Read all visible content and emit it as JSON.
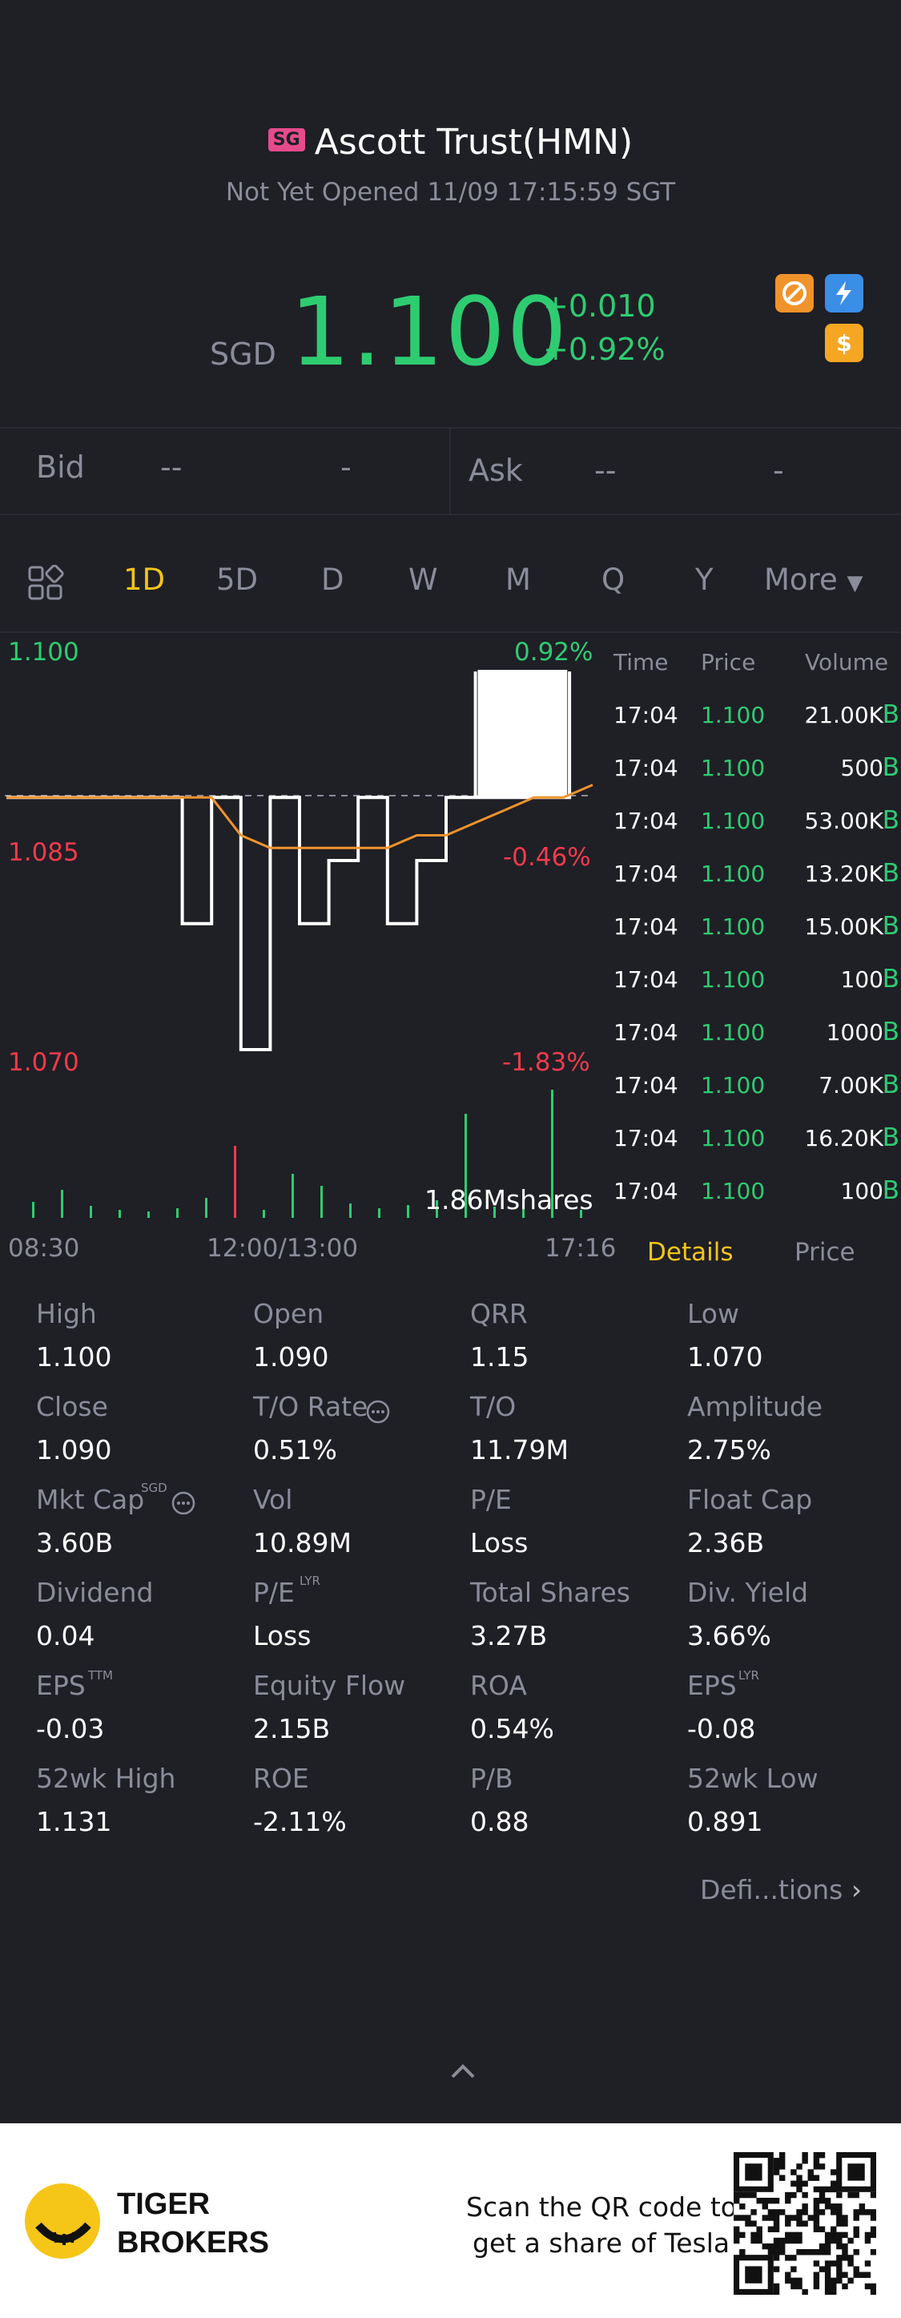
{
  "header": {
    "market_badge": "SG",
    "title": "Ascott Trust(HMN)",
    "status": "Not Yet Opened 11/09 17:15:59 SGT",
    "currency": "SGD",
    "price": "1.100",
    "change": "+0.010",
    "change_pct": "+0.92%"
  },
  "bidask": {
    "bid_label": "Bid",
    "bid_price": "--",
    "bid_size": "-",
    "ask_label": "Ask",
    "ask_price": "--",
    "ask_size": "-"
  },
  "tabs": [
    "1D",
    "5D",
    "D",
    "W",
    "M",
    "Q",
    "Y",
    "More"
  ],
  "active_tab": "1D",
  "chart": {
    "y_top": "1.100",
    "y_mid": "1.085",
    "y_bot": "1.070",
    "pct_top": "0.92%",
    "pct_mid": "-0.46%",
    "pct_bot": "-1.83%",
    "volume_label": "1.86Mshares",
    "x_start": "08:30",
    "x_mid": "12:00/13:00",
    "x_end": "17:16"
  },
  "chart_data": {
    "type": "line",
    "series": [
      {
        "values": [
          1.09,
          1.09,
          1.09,
          1.09,
          1.09,
          1.09,
          1.09,
          1.09,
          1.087,
          1.086,
          1.086,
          1.086,
          1.086,
          1.086,
          1.087,
          1.087,
          1.088,
          1.089,
          1.09,
          1.09,
          1.091
        ]
      },
      {
        "values": [
          1.09,
          1.09,
          1.09,
          1.09,
          1.09,
          1.09,
          1.08,
          1.09,
          1.07,
          1.09,
          1.08,
          1.085,
          1.09,
          1.08,
          1.085,
          1.09,
          1.1,
          1.09,
          1.1,
          1.09,
          1.1
        ]
      }
    ],
    "ylim": [
      1.07,
      1.1
    ]
  },
  "trades": {
    "headers": [
      "Time",
      "Price",
      "Volume"
    ],
    "rows": [
      {
        "time": "17:04",
        "price": "1.100",
        "volume": "21.00K",
        "side": "B"
      },
      {
        "time": "17:04",
        "price": "1.100",
        "volume": "500",
        "side": "B"
      },
      {
        "time": "17:04",
        "price": "1.100",
        "volume": "53.00K",
        "side": "B"
      },
      {
        "time": "17:04",
        "price": "1.100",
        "volume": "13.20K",
        "side": "B"
      },
      {
        "time": "17:04",
        "price": "1.100",
        "volume": "15.00K",
        "side": "B"
      },
      {
        "time": "17:04",
        "price": "1.100",
        "volume": "100",
        "side": "B"
      },
      {
        "time": "17:04",
        "price": "1.100",
        "volume": "1000",
        "side": "B"
      },
      {
        "time": "17:04",
        "price": "1.100",
        "volume": "7.00K",
        "side": "B"
      },
      {
        "time": "17:04",
        "price": "1.100",
        "volume": "16.20K",
        "side": "B"
      },
      {
        "time": "17:04",
        "price": "1.100",
        "volume": "100",
        "side": "B"
      }
    ],
    "tab_details": "Details",
    "tab_price": "Price"
  },
  "details": [
    [
      {
        "label": "High",
        "value": "1.100"
      },
      {
        "label": "Open",
        "value": "1.090"
      },
      {
        "label": "QRR",
        "value": "1.15"
      },
      {
        "label": "Low",
        "value": "1.070"
      }
    ],
    [
      {
        "label": "Close",
        "value": "1.090"
      },
      {
        "label": "T/O Rate",
        "value": "0.51%"
      },
      {
        "label": "T/O",
        "value": "11.79M"
      },
      {
        "label": "Amplitude",
        "value": "2.75%"
      }
    ],
    [
      {
        "label": "Mkt Cap",
        "value": "3.60B"
      },
      {
        "label": "Vol",
        "value": "10.89M"
      },
      {
        "label": "P/E",
        "value": "Loss"
      },
      {
        "label": "Float Cap",
        "value": "2.36B"
      }
    ],
    [
      {
        "label": "Dividend",
        "value": "0.04"
      },
      {
        "label": "P/E",
        "value": "Loss"
      },
      {
        "label": "Total Shares",
        "value": "3.27B"
      },
      {
        "label": "Div. Yield",
        "value": "3.66%"
      }
    ],
    [
      {
        "label": "EPS",
        "value": "-0.03"
      },
      {
        "label": "Equity Flow",
        "value": "2.15B"
      },
      {
        "label": "ROA",
        "value": "0.54%"
      },
      {
        "label": "EPS",
        "value": "-0.08"
      }
    ],
    [
      {
        "label": "52wk High",
        "value": "1.131"
      },
      {
        "label": "ROE",
        "value": "-2.11%"
      },
      {
        "label": "P/B",
        "value": "0.88"
      },
      {
        "label": "52wk Low",
        "value": "0.891"
      }
    ]
  ],
  "details_sups": {
    "mktcap": "SGD",
    "pe_lyr": "LYR",
    "eps_ttm": "TTM",
    "eps_lyr": "LYR"
  },
  "definitions_link": "Defi...tions",
  "footer": {
    "brand_line1": "TIGER",
    "brand_line2": "BROKERS",
    "promo_line1": "Scan the QR code to",
    "promo_line2": "get a share of Tesla"
  },
  "colors": {
    "green": "#2ecc71",
    "red": "#ef3b4c",
    "accent": "#f5c518",
    "avg_line": "#f0932b"
  }
}
